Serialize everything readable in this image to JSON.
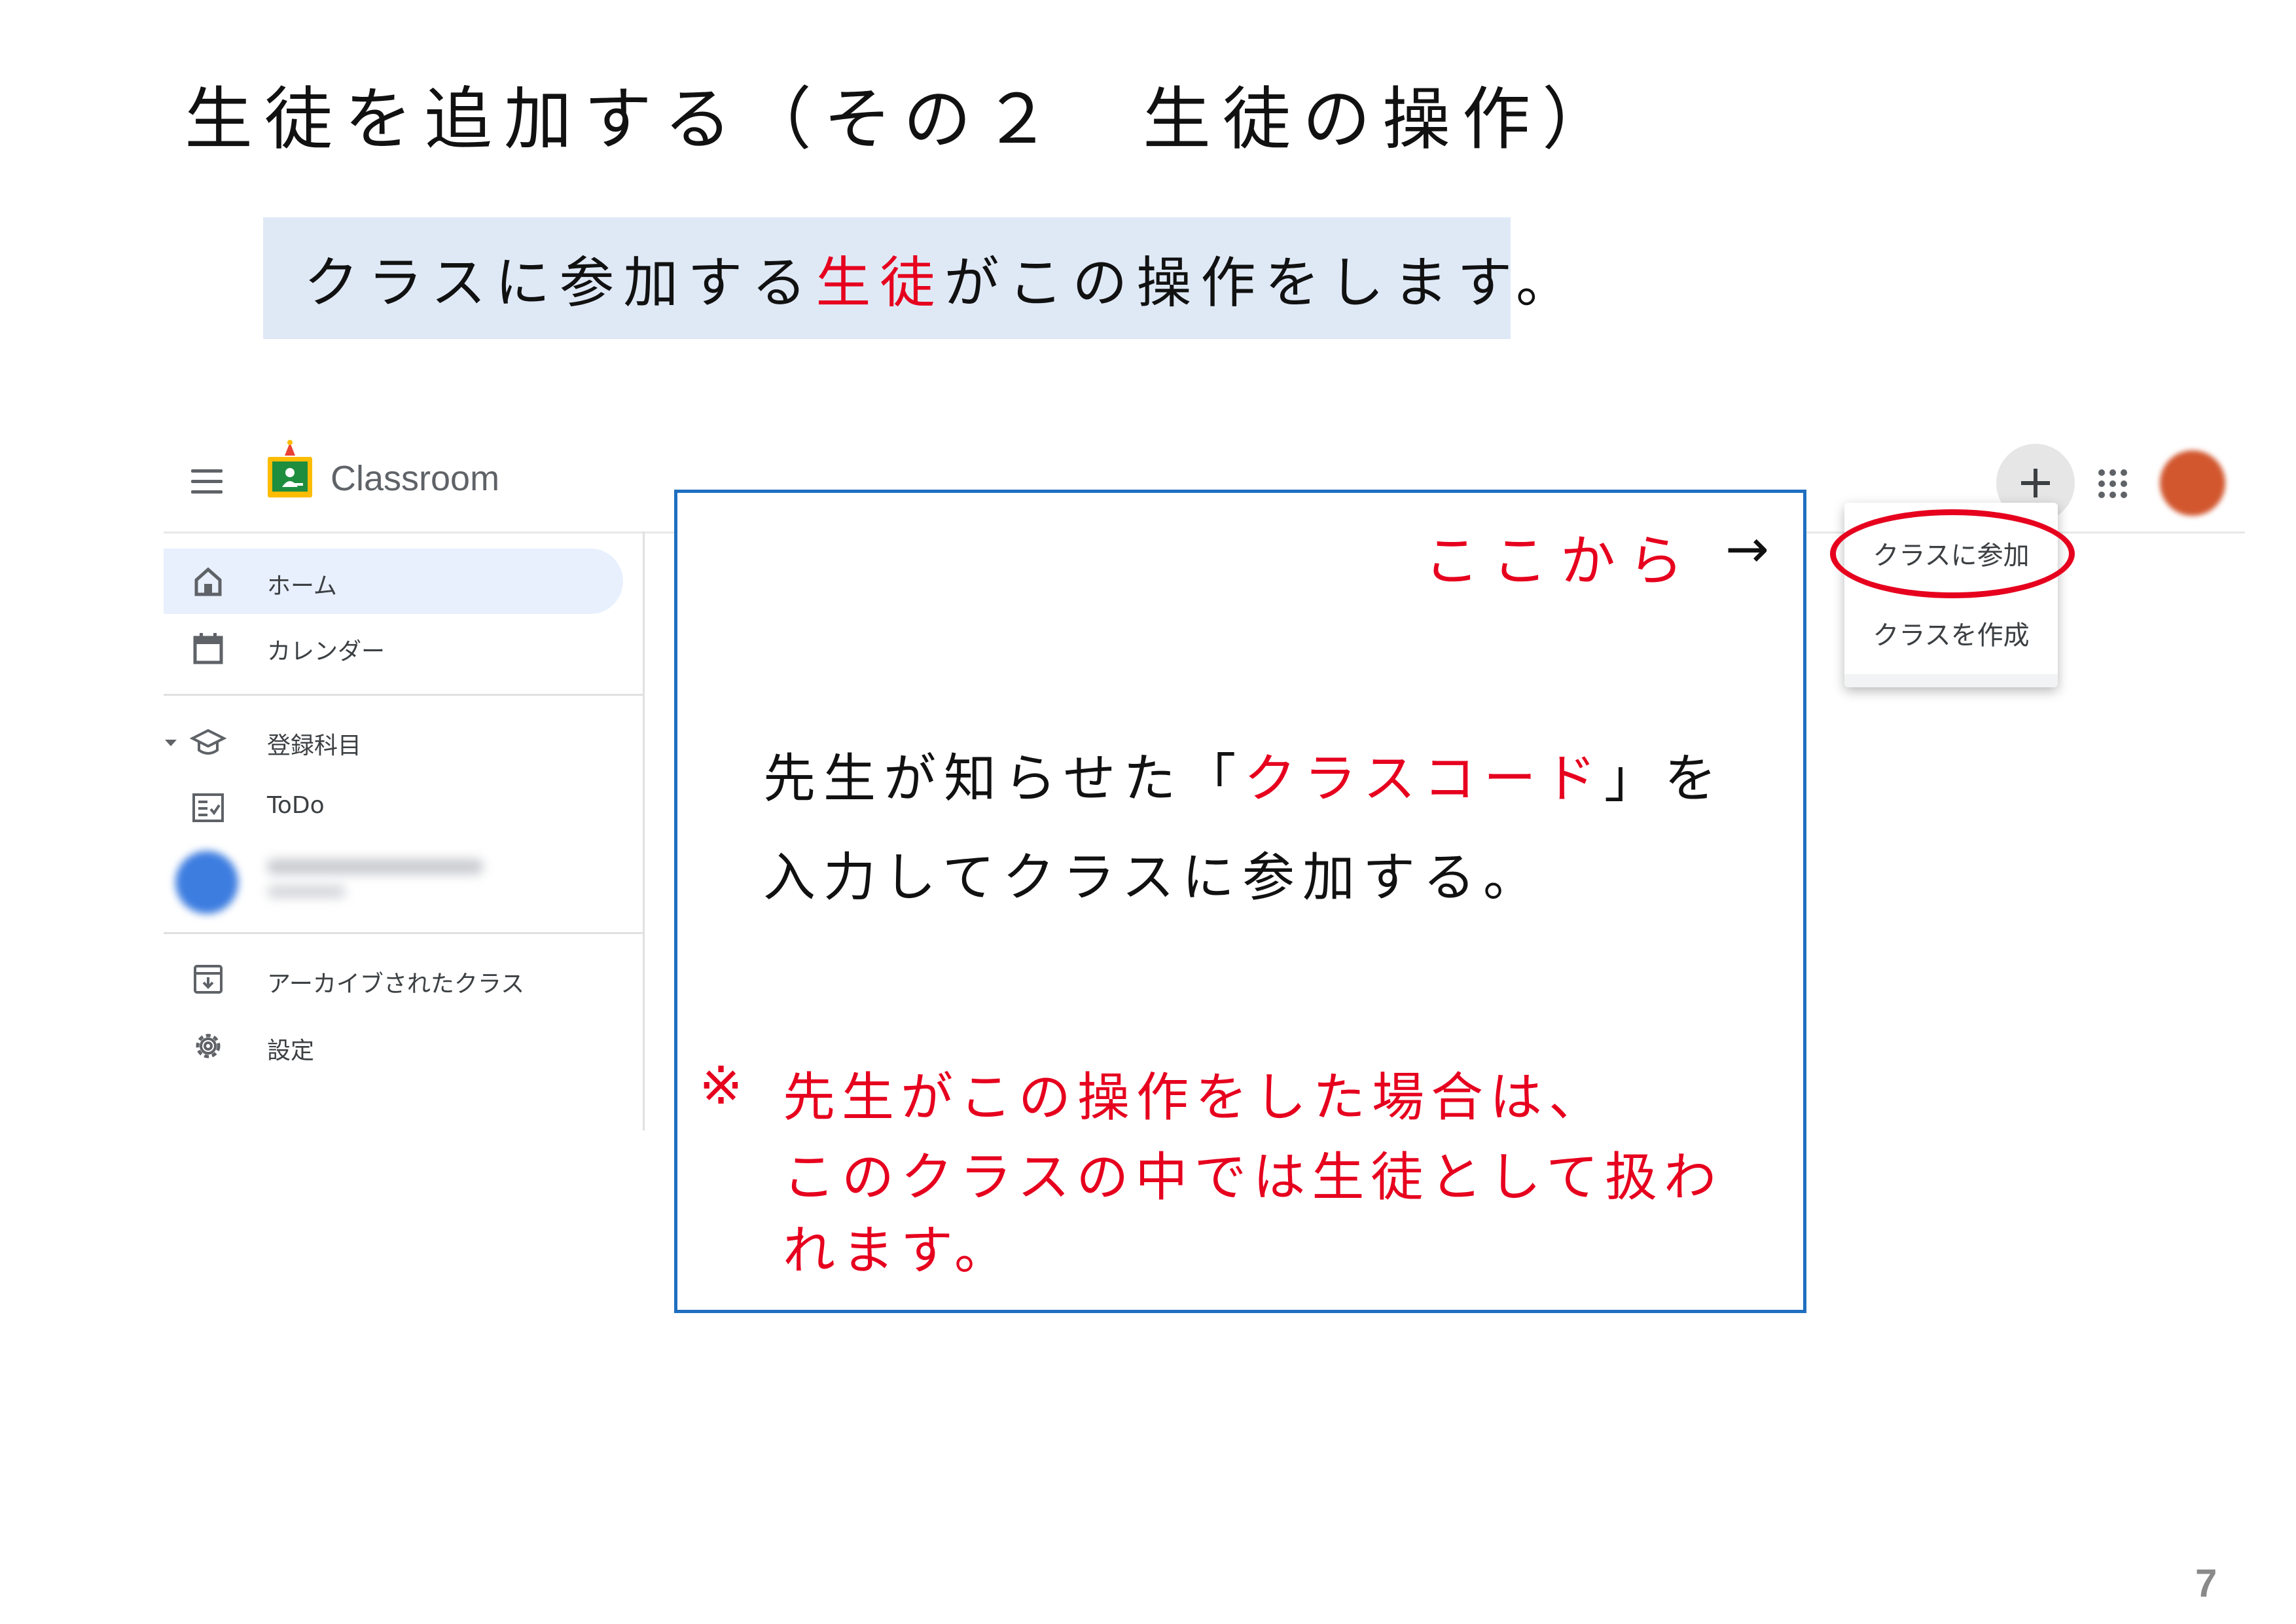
{
  "slide": {
    "title": "生徒を追加する（その２　生徒の操作）",
    "subtitle_pre": "クラスに参加する",
    "subtitle_highlight": "生徒",
    "subtitle_post": "がこの操作をします。",
    "page_number": "7"
  },
  "app": {
    "name": "Classroom",
    "icons": {
      "menu": "menu-icon",
      "logo": "classroom-logo-icon",
      "add": "plus-icon",
      "apps": "apps-grid-icon",
      "user": "user-avatar"
    }
  },
  "sidebar": {
    "items": [
      {
        "label": "ホーム",
        "icon": "home-icon",
        "active": true
      },
      {
        "label": "カレンダー",
        "icon": "calendar-icon"
      },
      {
        "label": "登録科目",
        "icon": "graduation-cap-icon"
      },
      {
        "label": "ToDo",
        "icon": "todo-list-icon"
      },
      {
        "label": "アーカイブされたクラス",
        "icon": "archive-icon"
      },
      {
        "label": "設定",
        "icon": "gear-icon"
      }
    ]
  },
  "dropdown": {
    "join_class": "クラスに参加",
    "create_class": "クラスを作成"
  },
  "callout": {
    "here_label": "ここから",
    "arrow": "→",
    "instruction_line1_pre": "先生が知らせた「",
    "instruction_line1_highlight": "クラスコード",
    "instruction_line1_post": "」を",
    "instruction_line2": "入力してクラスに参加する。",
    "note_mark": "※",
    "note_line1": "先生がこの操作をした場合は、",
    "note_line2": "このクラスの中では生徒として扱わ",
    "note_line3": "れます。"
  },
  "colors": {
    "accent_red": "#e6001e",
    "callout_border": "#1f6fbf",
    "subtitle_bg": "#dfe9f6",
    "active_nav_bg": "#e8f0fe"
  }
}
